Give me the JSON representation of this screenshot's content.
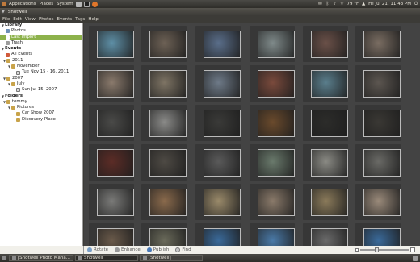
{
  "top_panel": {
    "menus": [
      "Applications",
      "Places",
      "System"
    ],
    "tray": {
      "temperature": "79 °F",
      "datetime": "Fri Jul 21, 11:43 PM"
    }
  },
  "window": {
    "title": "Shotwell"
  },
  "menubar": [
    "File",
    "Edit",
    "View",
    "Photos",
    "Events",
    "Tags",
    "Help"
  ],
  "sidebar": {
    "library_header": "Library",
    "library_items": [
      "Photos",
      "Last Import",
      "Trash"
    ],
    "events_header": "Events",
    "all_events": "All Events",
    "year_2011": "2011",
    "month_november": "November",
    "event_nov": "Tue Nov 15 - 16, 2011",
    "year_2007": "2007",
    "month_july": "July",
    "event_jul": "Sun Jul 15, 2007",
    "folders_header": "Folders",
    "folder_tommy": "tommy",
    "folder_pictures": "Pictures",
    "folder_car_show": "Car Show 2007",
    "folder_discovery": "Discovery Place"
  },
  "toolbar": {
    "rotate": "Rotate",
    "enhance": "Enhance",
    "publish": "Publish",
    "find": "Find"
  },
  "taskbar": [
    "[Shotwell Photo Mana...",
    "Shotwell",
    "[Shotwell]"
  ],
  "photos": [
    [
      "#5e8fa6",
      "#6d6155",
      "#5a6e8a",
      "#7f8a8a",
      "#6a5048",
      "#7a6d62"
    ],
    [
      "#8a7a6c",
      "#7e7464",
      "#6e7a88",
      "#7a4a3c",
      "#5a7e8c",
      "#5c5650"
    ],
    [
      "#4a4a48",
      "#8a8a88",
      "#3a3a38",
      "#6a4a2c",
      "#2c2c2a",
      "#3a3834"
    ],
    [
      "#5c2c26",
      "#4e4a44",
      "#5a5a5a",
      "#6a7a6c",
      "#8a8a84",
      "#6a6a66"
    ],
    [
      "#7a7a78",
      "#8a6a4c",
      "#9a8a6a",
      "#8a7a6a",
      "#8a7a5a",
      "#9a8a7a"
    ],
    [
      "#6a5a4a",
      "#6a6a5a",
      "#3a6a9a",
      "#4a7aa8",
      "#6a6a6a",
      "#3a6a9a"
    ]
  ]
}
